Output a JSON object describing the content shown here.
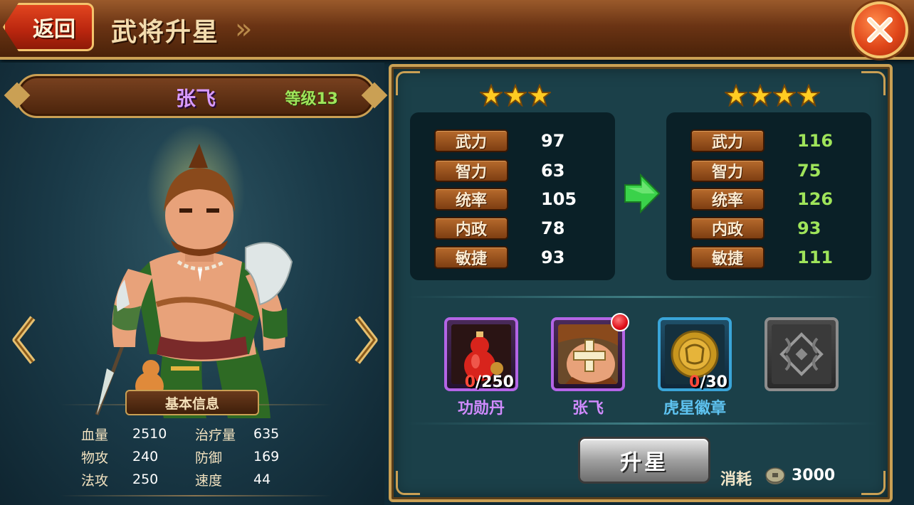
{
  "header": {
    "back_label": "返回",
    "title": "武将升星"
  },
  "hero": {
    "name": "张飞",
    "level": "等级13"
  },
  "basic_info": {
    "title": "基本信息",
    "rows": [
      {
        "k1": "血量",
        "v1": "2510",
        "k2": "治疗量",
        "v2": "635"
      },
      {
        "k1": "物攻",
        "v1": "240",
        "k2": "防御",
        "v2": "169"
      },
      {
        "k1": "法攻",
        "v1": "250",
        "k2": "速度",
        "v2": "44"
      }
    ]
  },
  "star_upgrade": {
    "current_stars": 3,
    "next_stars": 4,
    "current_stats": [
      {
        "label": "武力",
        "value": "97"
      },
      {
        "label": "智力",
        "value": "63"
      },
      {
        "label": "统率",
        "value": "105"
      },
      {
        "label": "内政",
        "value": "78"
      },
      {
        "label": "敏捷",
        "value": "93"
      }
    ],
    "next_stats": [
      {
        "label": "武力",
        "value": "116"
      },
      {
        "label": "智力",
        "value": "75"
      },
      {
        "label": "统率",
        "value": "126"
      },
      {
        "label": "内政",
        "value": "93"
      },
      {
        "label": "敏捷",
        "value": "111"
      }
    ]
  },
  "materials": [
    {
      "name": "功勋丹",
      "have": "0",
      "need": "/250"
    },
    {
      "name": "张飞",
      "have": "",
      "need": ""
    },
    {
      "name": "虎星徽章",
      "have": "0",
      "need": "/30"
    }
  ],
  "action": {
    "button_label": "升星",
    "cost_label": "消耗",
    "cost_value": "3000"
  },
  "colors": {
    "header_brown": "#6b3414",
    "gold_border": "#caa054",
    "stat_green": "#9fe45a",
    "name_purple": "#d08bff",
    "name_blue": "#5ec3f0"
  }
}
